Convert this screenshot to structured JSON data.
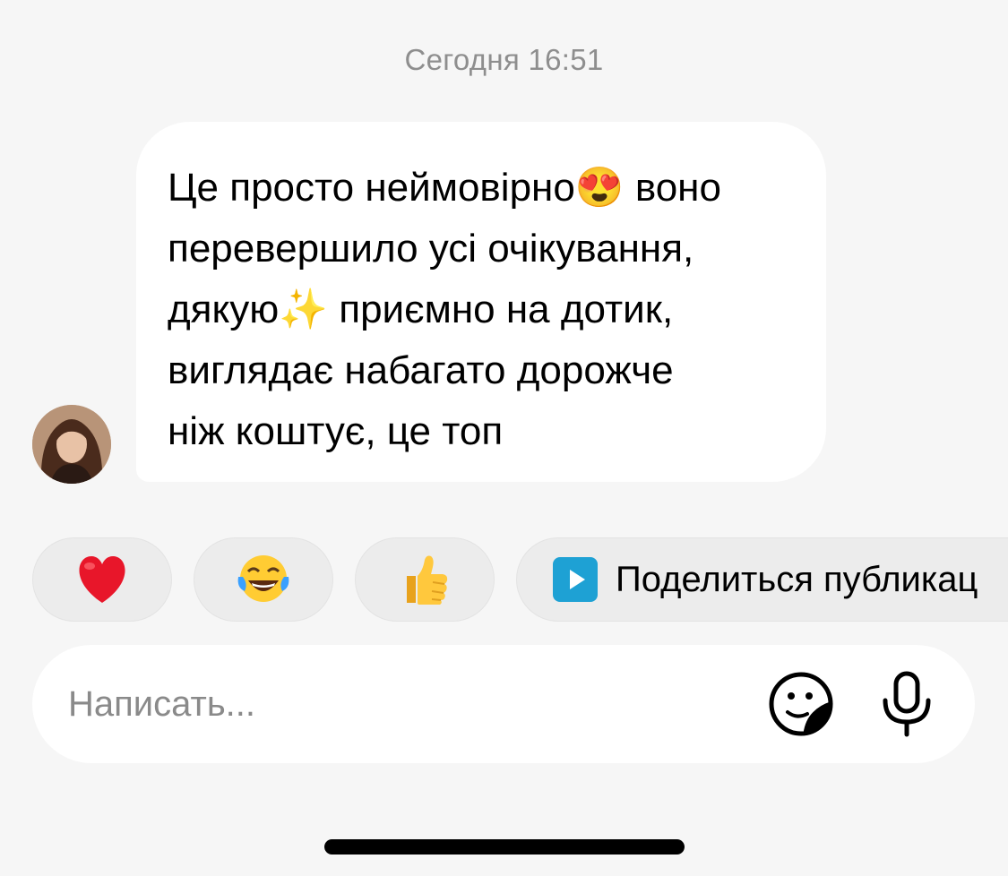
{
  "header": {
    "timestamp": "Сегодня 16:51"
  },
  "message": {
    "lines": [
      "Це просто неймовірно😍 воно",
      "перевершило усі очікування,",
      "дякую✨  приємно на дотик,",
      "виглядає набагато дорожче",
      "ніж коштує, це топ"
    ],
    "bubble_color": "#ffffff"
  },
  "quick_reactions": [
    {
      "emoji": "❤️",
      "icon": "red-heart"
    },
    {
      "emoji": "😂",
      "icon": "tears-of-joy"
    },
    {
      "emoji": "👍",
      "icon": "thumbs-up"
    }
  ],
  "share_chip": {
    "label": "Поделиться публикац",
    "icon": "play-icon",
    "icon_color": "#1ea1d4"
  },
  "composer": {
    "placeholder": "Написать...",
    "value": ""
  },
  "colors": {
    "background": "#f6f6f6",
    "timestamp": "#8e8e8e",
    "chip_background": "#ececec",
    "placeholder": "#8a8a8a"
  }
}
